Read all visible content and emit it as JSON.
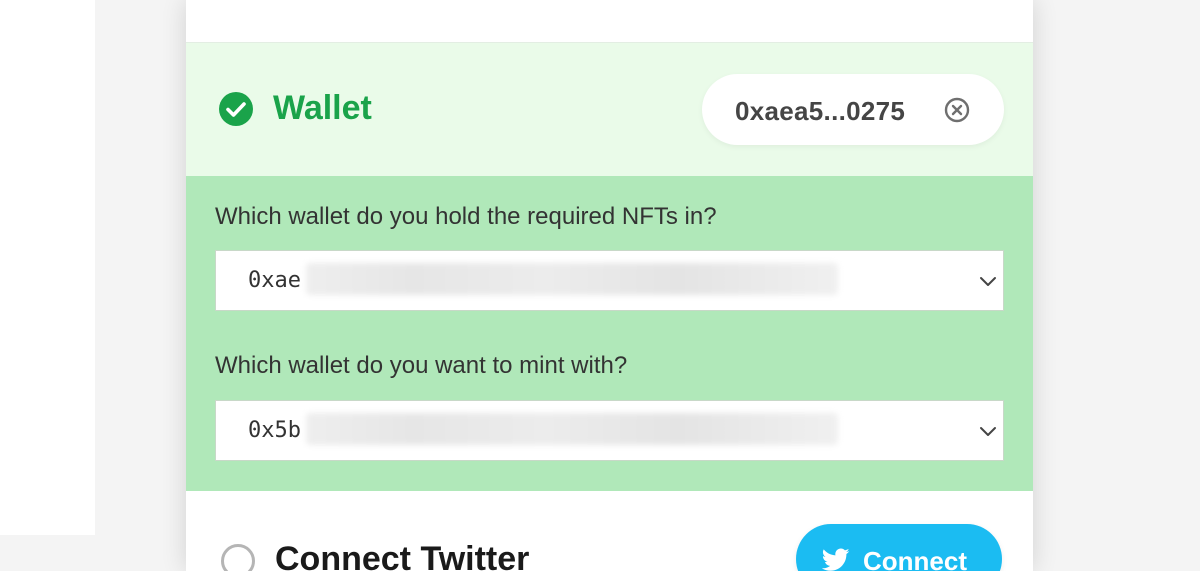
{
  "colors": {
    "success_green": "#1aa34a",
    "panel_green": "#b0e8b9",
    "header_green": "#eafbe9",
    "twitter_blue": "#1bbcf2"
  },
  "wallet": {
    "title": "Wallet",
    "status_icon": "check-circle-icon",
    "address_short": "0xaea5...0275",
    "clear_icon": "x-circle-icon"
  },
  "form": {
    "hold_label": "Which wallet do you hold the required NFTs in?",
    "hold_select_value": "0xae",
    "mint_label": "Which wallet do you want to mint with?",
    "mint_select_value": "0x5b"
  },
  "twitter": {
    "title": "Connect Twitter",
    "button_label": "Connect",
    "button_icon": "twitter-bird-icon"
  }
}
